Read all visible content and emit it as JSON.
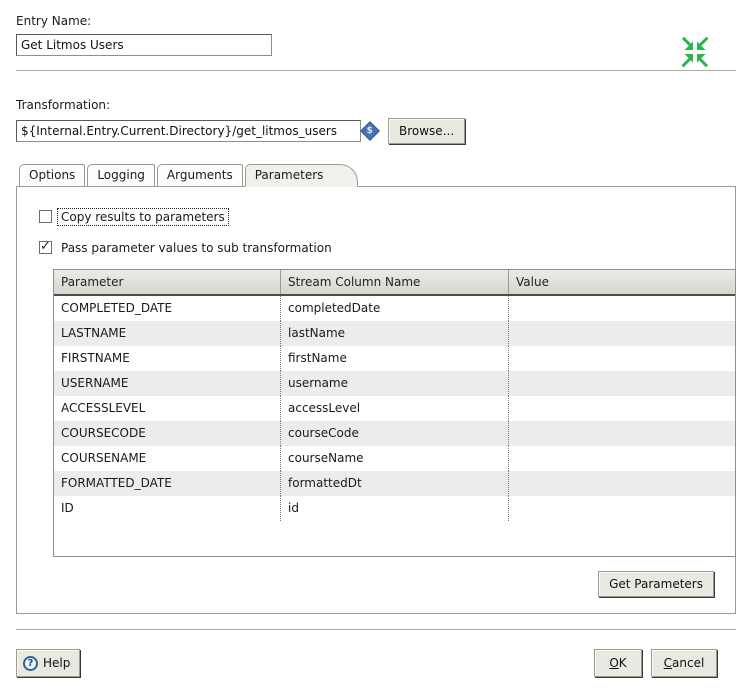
{
  "colors": {
    "accent_green": "#2fb34c",
    "variable_blue": "#4a72b0",
    "help_blue": "#2f6496"
  },
  "entry": {
    "label": "Entry Name:",
    "value": "Get Litmos Users"
  },
  "transformation": {
    "label": "Transformation:",
    "value": "${Internal.Entry.Current.Directory}/get_litmos_users",
    "variable_indicator": "$",
    "browse_label": "Browse..."
  },
  "tabs": [
    {
      "label": "Options",
      "active": false
    },
    {
      "label": "Logging",
      "active": false
    },
    {
      "label": "Arguments",
      "active": false
    },
    {
      "label": "Parameters",
      "active": true
    }
  ],
  "parameters_tab": {
    "copy_results": {
      "label": "Copy results to parameters",
      "checked": false
    },
    "pass_values": {
      "label": "Pass parameter values to sub transformation",
      "checked": true
    },
    "table": {
      "headers": [
        "Parameter",
        "Stream Column Name",
        "Value"
      ],
      "rows": [
        [
          "COMPLETED_DATE",
          "completedDate",
          ""
        ],
        [
          "LASTNAME",
          "lastName",
          ""
        ],
        [
          "FIRSTNAME",
          "firstName",
          ""
        ],
        [
          "USERNAME",
          "username",
          ""
        ],
        [
          "ACCESSLEVEL",
          "accessLevel",
          ""
        ],
        [
          "COURSECODE",
          "courseCode",
          ""
        ],
        [
          "COURSENAME",
          "courseName",
          ""
        ],
        [
          "FORMATTED_DATE",
          "formattedDt",
          ""
        ],
        [
          "ID",
          "id",
          ""
        ]
      ]
    },
    "get_parameters_label": "Get Parameters"
  },
  "footer": {
    "help_label": "Help",
    "help_icon_glyph": "?",
    "ok_mnemonic": "O",
    "ok_rest": "K",
    "cancel_mnemonic": "C",
    "cancel_rest": "ancel"
  }
}
